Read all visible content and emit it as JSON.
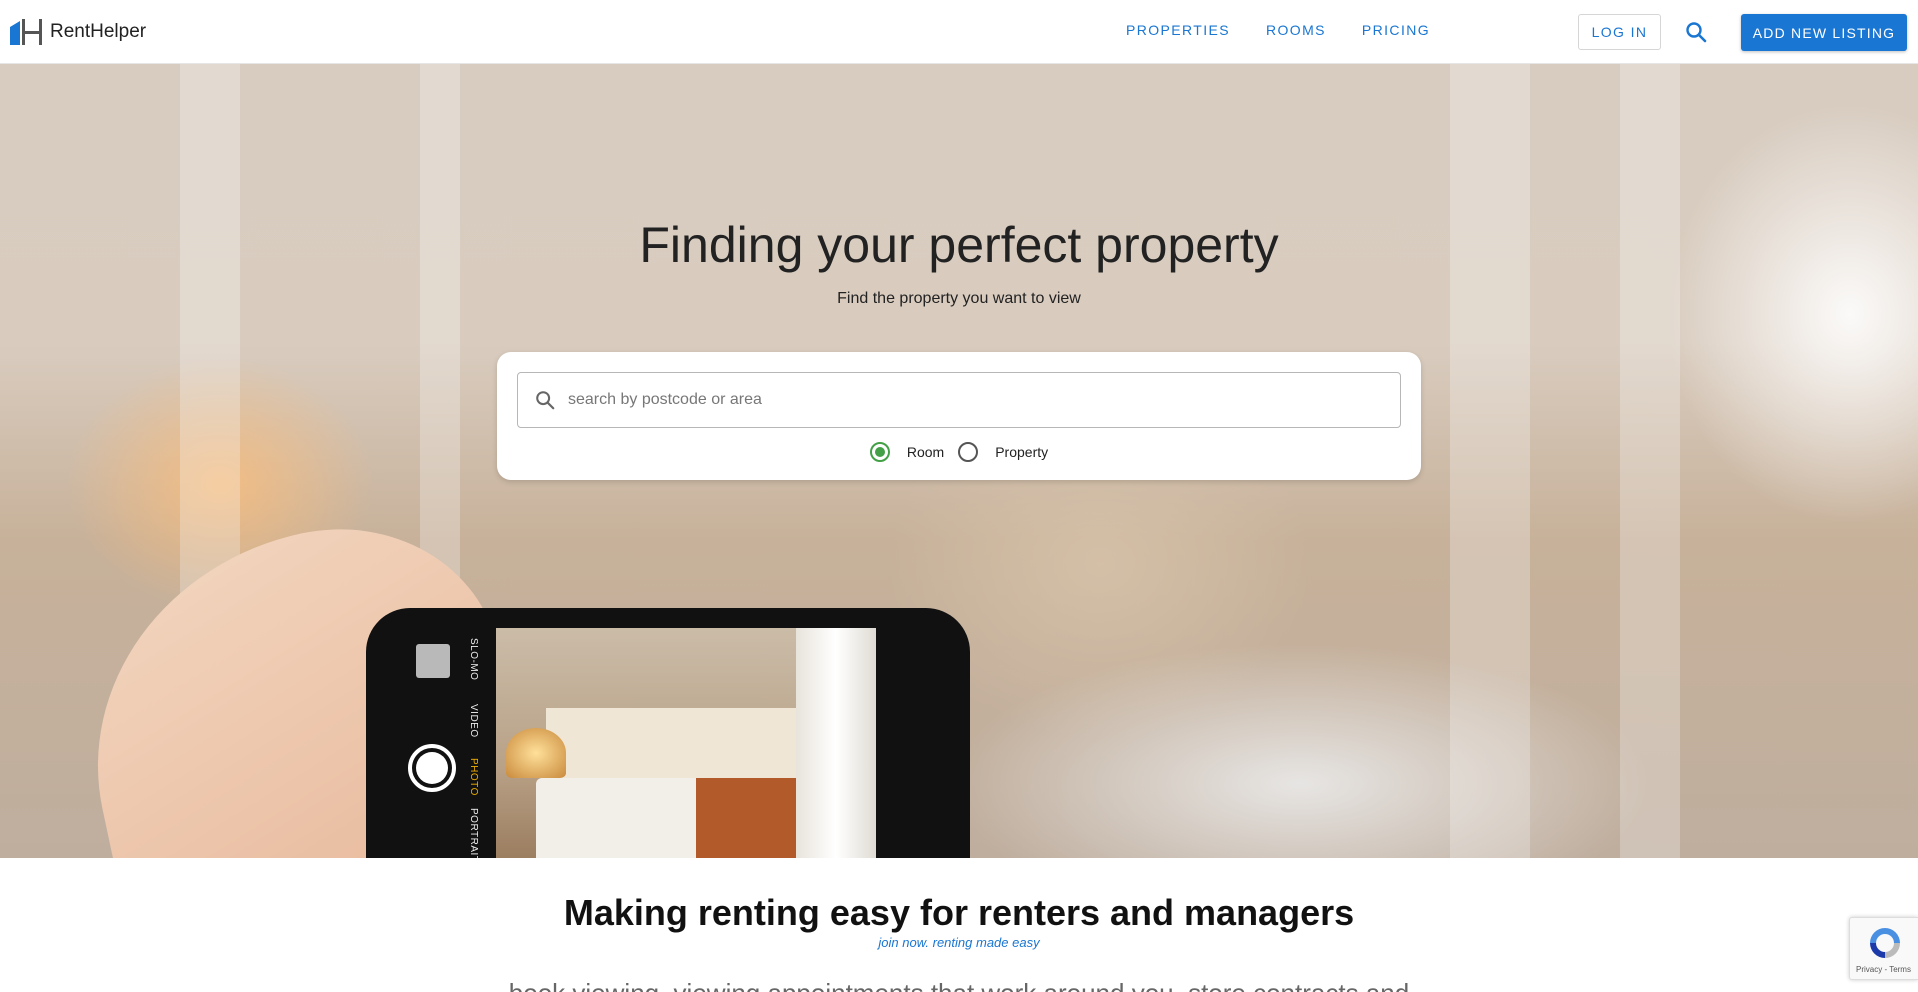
{
  "header": {
    "brand_name": "RentHelper",
    "nav": [
      {
        "label": "PROPERTIES"
      },
      {
        "label": "ROOMS"
      },
      {
        "label": "PRICING"
      }
    ],
    "login_label": "LOG IN",
    "add_listing_label": "ADD NEW LISTING"
  },
  "hero": {
    "title": "Finding your perfect property",
    "subtitle": "Find the property you want to view",
    "search": {
      "placeholder": "search by postcode or area",
      "value": ""
    },
    "type_options": [
      {
        "label": "Room",
        "checked": true
      },
      {
        "label": "Property",
        "checked": false
      }
    ],
    "camera_modes": [
      "SLO-MO",
      "VIDEO",
      "PHOTO",
      "PORTRAIT"
    ]
  },
  "lower": {
    "title": "Making renting easy for renters and managers",
    "tagline": "join now. renting made easy",
    "description": "book viewing, viewing appointments that work around you, store contracts and"
  },
  "recaptcha": {
    "text": "Privacy - Terms"
  },
  "colors": {
    "primary": "#1976d2",
    "radio_checked": "#43a047"
  }
}
